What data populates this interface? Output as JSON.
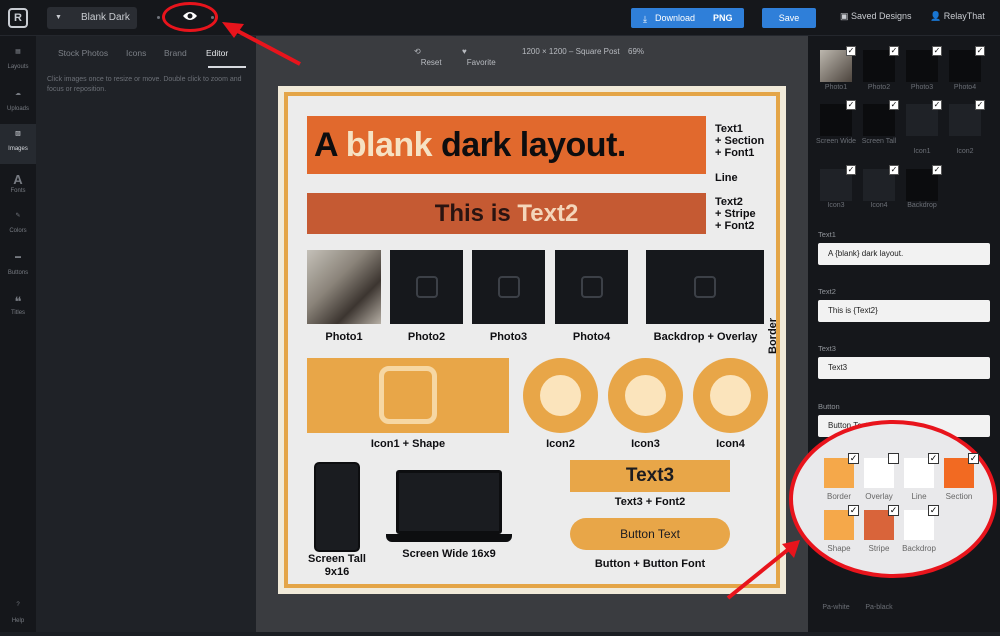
{
  "topbar": {
    "design_name": "Blank Dark",
    "download_label": "Download",
    "format_label": "PNG",
    "save_label": "Save",
    "saved_designs_label": "Saved Designs",
    "user_label": "RelayThat"
  },
  "rail": {
    "items": [
      {
        "label": "Layouts",
        "icon": "layouts-icon"
      },
      {
        "label": "Uploads",
        "icon": "upload-icon"
      },
      {
        "label": "Images",
        "icon": "image-icon"
      },
      {
        "label": "Fonts",
        "icon": "font-icon"
      },
      {
        "label": "Colors",
        "icon": "brush-icon"
      },
      {
        "label": "Buttons",
        "icon": "button-icon"
      },
      {
        "label": "Titles",
        "icon": "quote-icon"
      },
      {
        "label": "Help",
        "icon": "help-icon"
      }
    ]
  },
  "panel": {
    "tabs": [
      "Stock Photos",
      "Icons",
      "Brand",
      "Editor"
    ],
    "active_tab": "Editor",
    "hint": "Click images once to resize or move. Double click to zoom and focus or reposition."
  },
  "canvas_toolbar": {
    "reset": "Reset",
    "favorite": "Favorite",
    "size": "1200 × 1200 – Square Post",
    "zoom": "69%"
  },
  "artboard": {
    "text1_a": "A ",
    "text1_b": "blank",
    "text1_c": " dark layout.",
    "label_text1": "Text1\n+ Section\n+ Font1",
    "label_line": "Line",
    "text2_a": "This is ",
    "text2_b": "Text2",
    "label_text2": "Text2\n+ Stripe\n+ Font2",
    "captions": [
      "Photo1",
      "Photo2",
      "Photo3",
      "Photo4",
      "Backdrop + Overlay"
    ],
    "icon_caps": [
      "Icon1 + Shape",
      "Icon2",
      "Icon3",
      "Icon4"
    ],
    "screen_tall": "Screen Tall\n9x16",
    "screen_wide": "Screen Wide 16x9",
    "text3": "Text3",
    "text3_cap": "Text3 + Font2",
    "button_text": "Button Text",
    "button_cap": "Button + Button Font",
    "border": "Border"
  },
  "rpanel": {
    "thumbs": [
      "Photo1",
      "Photo2",
      "Photo3",
      "Photo4",
      "Screen Wide",
      "Screen Tall",
      "Icon1",
      "Icon2",
      "Icon3",
      "Icon4",
      "Backdrop"
    ],
    "fields": [
      {
        "label": "Text1",
        "value": "A {blank} dark layout."
      },
      {
        "label": "Text2",
        "value": "This is {Text2}"
      },
      {
        "label": "Text3",
        "value": "Text3"
      },
      {
        "label": "Button",
        "value": "Button Text"
      }
    ],
    "bottom": [
      "Pa-white",
      "Pa-black"
    ]
  },
  "popup": {
    "swatches": [
      {
        "label": "Border",
        "color": "#f5a84a",
        "checked": true
      },
      {
        "label": "Overlay",
        "color": "#ffffff",
        "checked": false
      },
      {
        "label": "Line",
        "color": "#ffffff",
        "checked": true
      },
      {
        "label": "Section",
        "color": "#f26a22",
        "checked": true
      },
      {
        "label": "Shape",
        "color": "#f5a84a",
        "checked": true
      },
      {
        "label": "Stripe",
        "color": "#d9643a",
        "checked": true
      },
      {
        "label": "Backdrop",
        "color": "#ffffff",
        "checked": true
      }
    ]
  },
  "colors": {
    "accent": "#2f7fd9",
    "highlight": "#e8141c",
    "orange": "#e8a648"
  }
}
